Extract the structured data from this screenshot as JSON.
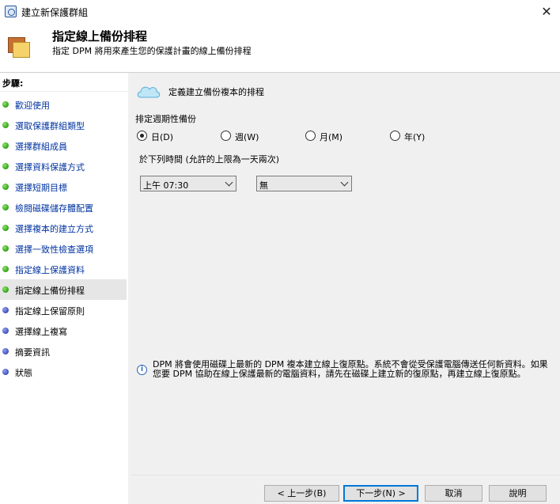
{
  "window": {
    "title": "建立新保護群組",
    "close_glyph": "✕"
  },
  "header": {
    "title": "指定線上備份排程",
    "subtitle": "指定 DPM 將用來產生您的保護計畫的線上備份排程"
  },
  "steps": {
    "title": "步驟:",
    "items": [
      {
        "label": "歡迎使用",
        "state": "done"
      },
      {
        "label": "選取保護群組類型",
        "state": "done"
      },
      {
        "label": "選擇群組成員",
        "state": "done"
      },
      {
        "label": "選擇資料保護方式",
        "state": "done"
      },
      {
        "label": "選擇短期目標",
        "state": "done"
      },
      {
        "label": "檢閱磁碟儲存體配置",
        "state": "done"
      },
      {
        "label": "選擇複本的建立方式",
        "state": "done"
      },
      {
        "label": "選擇一致性檢查選項",
        "state": "done"
      },
      {
        "label": "指定線上保護資料",
        "state": "done"
      },
      {
        "label": "指定線上備份排程",
        "state": "current"
      },
      {
        "label": "指定線上保留原則",
        "state": "pending"
      },
      {
        "label": "選擇線上複寫",
        "state": "pending"
      },
      {
        "label": "摘要資訊",
        "state": "pending"
      },
      {
        "label": "狀態",
        "state": "pending"
      }
    ]
  },
  "main": {
    "section_title": "定義建立備份複本的排程",
    "period_label": "排定週期性備份",
    "radios": [
      {
        "label": "日(D)",
        "checked": true
      },
      {
        "label": "週(W)",
        "checked": false
      },
      {
        "label": "月(M)",
        "checked": false
      },
      {
        "label": "年(Y)",
        "checked": false
      }
    ],
    "time_label": "於下列時間 (允許的上限為一天兩次)",
    "time1_value": "上午 07:30",
    "time2_value": "無",
    "info_text": "DPM 將會使用磁碟上最新的 DPM 複本建立線上復原點。系統不會從受保護電腦傳送任何新資料。如果您要 DPM 協助在線上保護最新的電腦資料，請先在磁碟上建立新的復原點，再建立線上復原點。"
  },
  "buttons": {
    "back": "< 上一步(B)",
    "next": "下一步(N) >",
    "cancel": "取消",
    "help": "說明"
  },
  "colors": {
    "done_dot": "#2ea313",
    "pending_dot": "#3f4fb7",
    "link": "#0033a0",
    "accent": "#0078d7"
  },
  "icons": [
    "app-icon",
    "close-icon",
    "folders-icon",
    "cloud-icon",
    "info-icon",
    "chevron-down-icon"
  ]
}
